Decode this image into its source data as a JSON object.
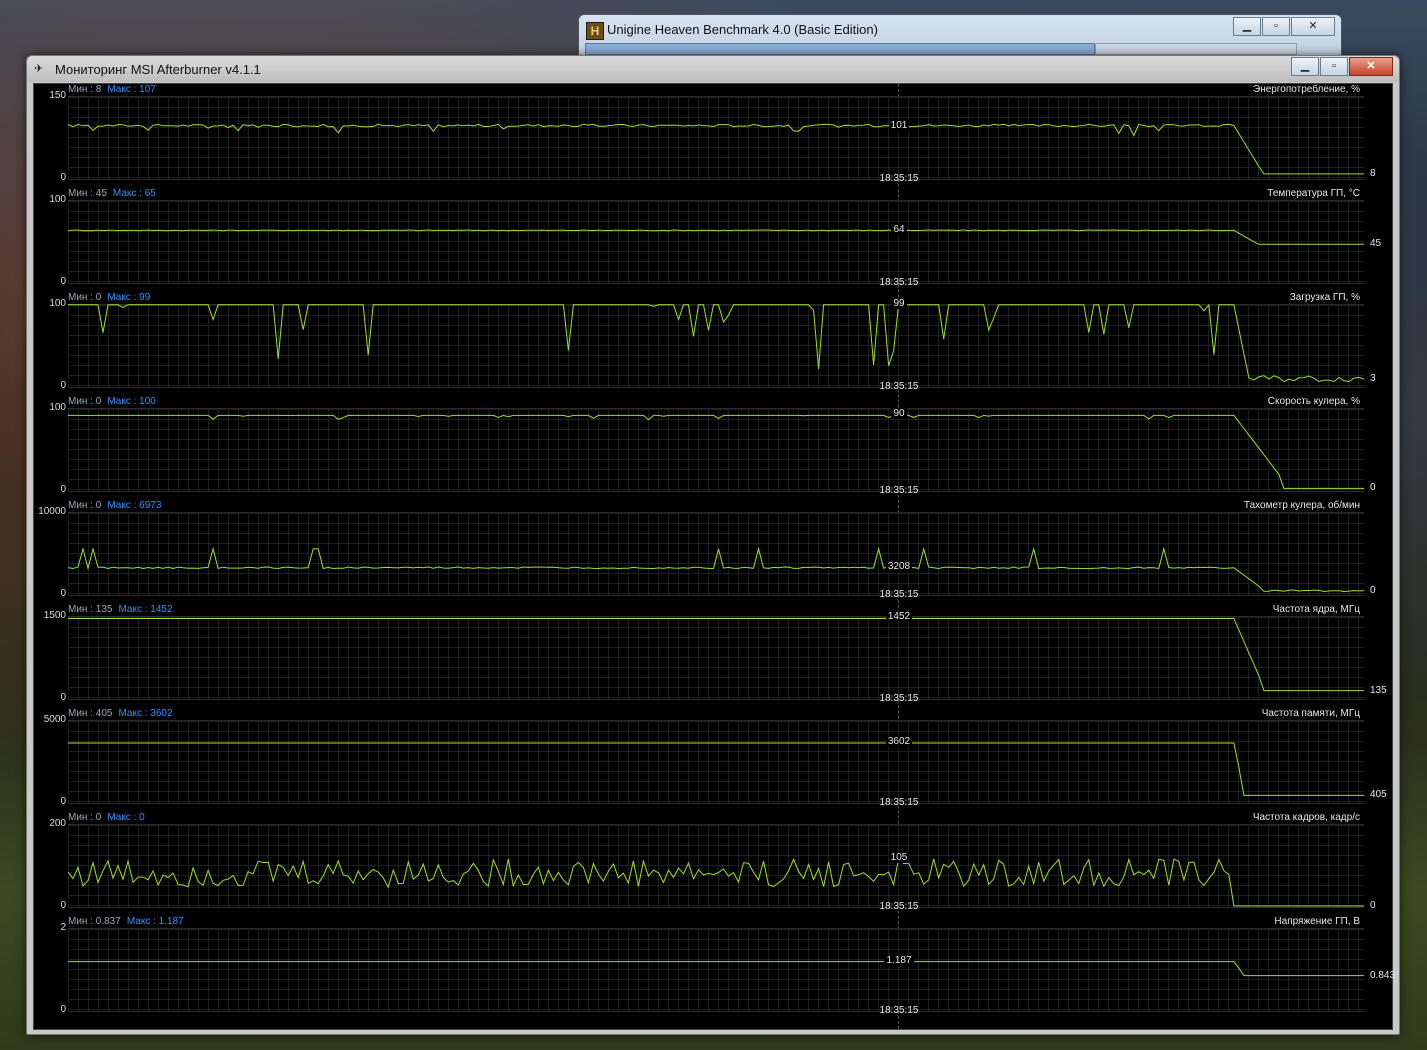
{
  "desktop": {},
  "heaven_window": {
    "title": "Unigine Heaven Benchmark 4.0 (Basic Edition)",
    "buttons": {
      "minimize": "▁",
      "maximize": "▫",
      "close": "✕"
    }
  },
  "afterburner": {
    "title": "Мониторинг MSI Afterburner v4.1.1",
    "buttons": {
      "minimize": "▁",
      "maximize": "▫",
      "close": "✕"
    },
    "cursor_time": "18:35:15"
  },
  "panels": [
    {
      "title": "Энергопотребление, %",
      "min_label": "Мин : 8",
      "max_label": "Макс : 107",
      "y_max": "150",
      "y_min": "0",
      "cursor_value": "101",
      "current": "8",
      "ymax_num": 150
    },
    {
      "title": "Температура ГП, °С",
      "min_label": "Мин : 45",
      "max_label": "Макс : 65",
      "y_max": "100",
      "y_min": "0",
      "cursor_value": "64",
      "current": "45",
      "ymax_num": 100
    },
    {
      "title": "Загрузка ГП, %",
      "min_label": "Мин : 0",
      "max_label": "Макс : 99",
      "y_max": "100",
      "y_min": "0",
      "cursor_value": "99",
      "current": "3",
      "ymax_num": 100
    },
    {
      "title": "Скорость кулера, %",
      "min_label": "Мин : 0",
      "max_label": "Макс : 100",
      "y_max": "100",
      "y_min": "0",
      "cursor_value": "90",
      "current": "0",
      "ymax_num": 100
    },
    {
      "title": "Тахометр кулера, об/мин",
      "min_label": "Мин : 0",
      "max_label": "Макс : 6973",
      "y_max": "10000",
      "y_min": "0",
      "cursor_value": "3208",
      "current": "0",
      "ymax_num": 10000
    },
    {
      "title": "Частота ядра, МГц",
      "min_label": "Мин : 135",
      "max_label": "Макс : 1452",
      "y_max": "1500",
      "y_min": "0",
      "cursor_value": "1452",
      "current": "135",
      "ymax_num": 1500
    },
    {
      "title": "Частота памяти, МГц",
      "min_label": "Мин : 405",
      "max_label": "Макс : 3602",
      "y_max": "5000",
      "y_min": "0",
      "cursor_value": "3602",
      "current": "405",
      "ymax_num": 5000
    },
    {
      "title": "Частота кадров, кадр/с",
      "min_label": "Мин : 0",
      "max_label": "Макс : 0",
      "y_max": "200",
      "y_min": "0",
      "cursor_value": "105",
      "current": "0",
      "ymax_num": 200
    },
    {
      "title": "Напряжение ГП, В",
      "min_label": "Мин : 0.837",
      "max_label": "Макс : 1.187",
      "y_max": "2",
      "y_min": "0",
      "cursor_value": "1.187",
      "current": "0.843",
      "ymax_num": 2
    }
  ],
  "colors": {
    "trace": "#9be22d",
    "grid": "#1e1e1e",
    "max_label": "#3b8cff",
    "min_label": "#9aa7b4"
  }
}
